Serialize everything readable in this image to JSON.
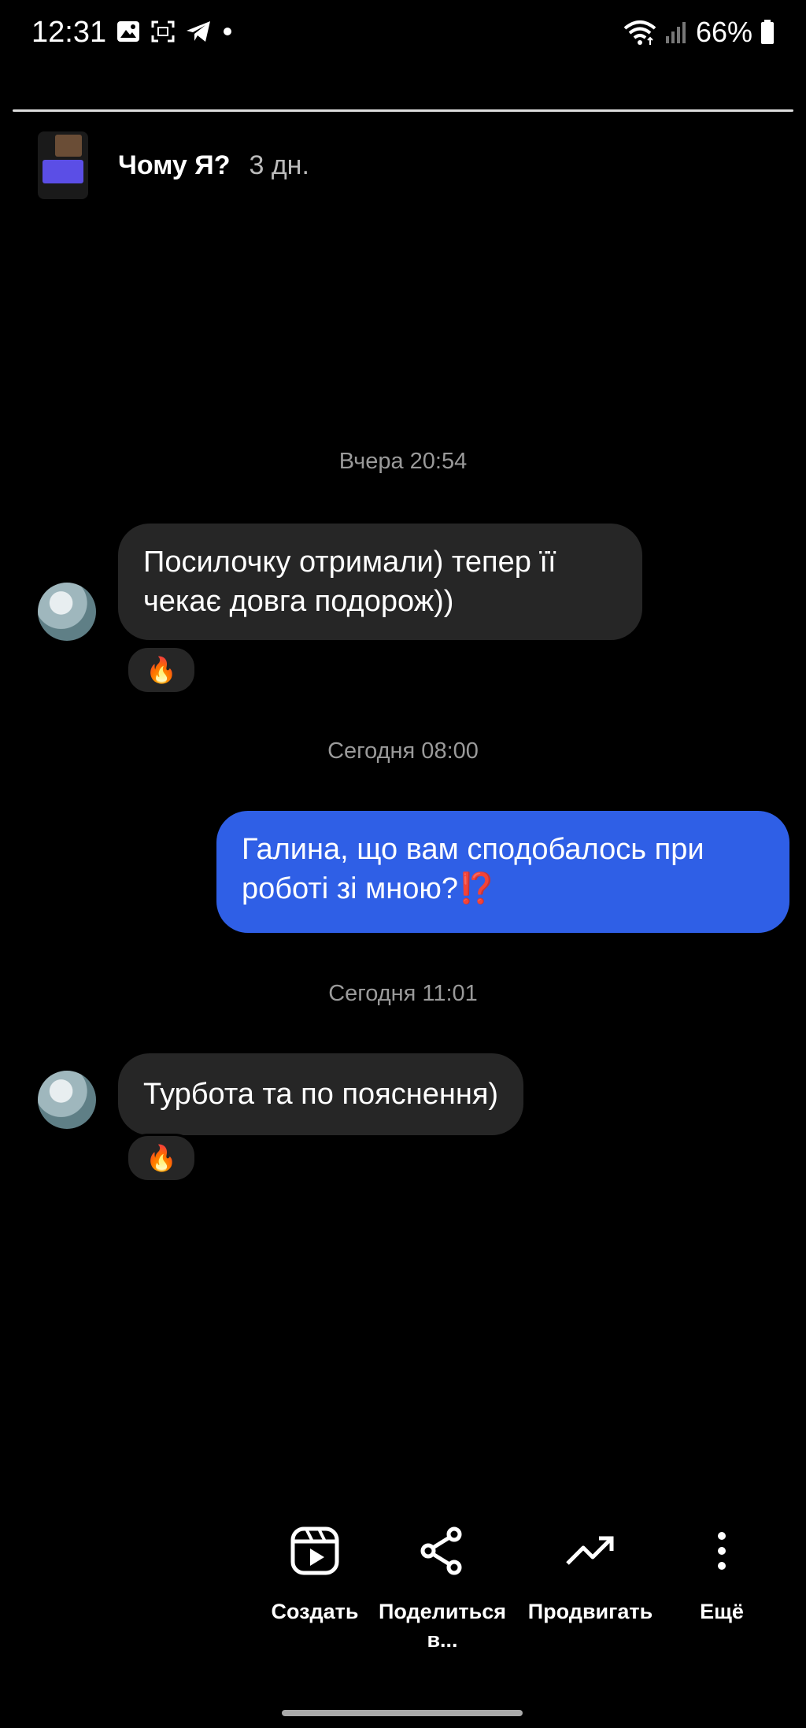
{
  "status_bar": {
    "time": "12:31",
    "battery": "66%",
    "icons_left": [
      "gallery-icon",
      "screenshot-icon",
      "telegram-icon",
      "dot-icon"
    ],
    "icons_right": [
      "wifi-icon",
      "signal-icon",
      "battery-icon"
    ]
  },
  "story": {
    "title": "Чому Я?",
    "age": "3 дн."
  },
  "chat": {
    "timestamp_1": "Вчера 20:54",
    "msg_1": "Посилочку отримали) тепер її чекає довга подорож))",
    "reaction_1": "🔥",
    "timestamp_2": "Сегодня 08:00",
    "msg_2_text": "Галина, що вам сподобалось при роботі зі мною?",
    "msg_2_emoji": "⁉️",
    "timestamp_3": "Сегодня 11:01",
    "msg_3": "Турбота та по пояснення)",
    "reaction_2": "🔥"
  },
  "actions": {
    "create": "Создать",
    "share_line1": "Поделиться",
    "share_line2": "в...",
    "promote": "Продвигать",
    "more": "Ещё"
  },
  "colors": {
    "background": "#000000",
    "bubble_in": "#262626",
    "bubble_out": "#2f5fe6"
  }
}
